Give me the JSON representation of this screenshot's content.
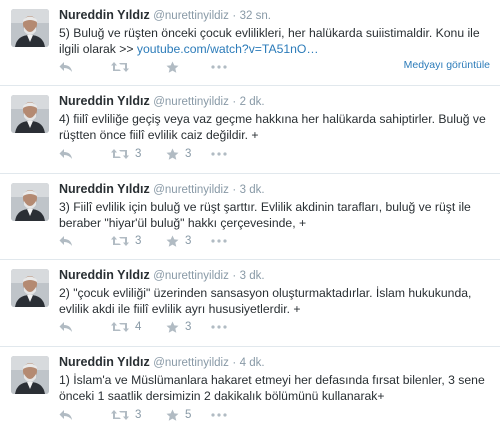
{
  "tweets": [
    {
      "name": "Nureddin Yıldız",
      "handle": "@nurettinyildiz",
      "time": "32 sn.",
      "text": "5) Buluğ ve rüşten önceki çocuk evlilikleri, her halükarda suiistimaldir. Konu ile ilgili olarak >> ",
      "link": "youtube.com/watch?v=TA51nO…",
      "retweets": "",
      "favorites": "",
      "media_label": "Medyayı görüntüle"
    },
    {
      "name": "Nureddin Yıldız",
      "handle": "@nurettinyildiz",
      "time": "2 dk.",
      "text": "4) fiilî evliliğe geçiş veya vaz geçme hakkına her halükarda sahiptirler. Buluğ ve rüştten önce fiilî evlilik caiz değildir. +",
      "retweets": "3",
      "favorites": "3"
    },
    {
      "name": "Nureddin Yıldız",
      "handle": "@nurettinyildiz",
      "time": "3 dk.",
      "text": "3) Fiilî evlilik için buluğ ve rüşt şarttır. Evlilik akdinin tarafları, buluğ ve rüşt ile beraber \"hiyar'ül buluğ\" hakkı çerçevesinde, +",
      "retweets": "3",
      "favorites": "3"
    },
    {
      "name": "Nureddin Yıldız",
      "handle": "@nurettinyildiz",
      "time": "3 dk.",
      "text": "2)  \"çocuk evliliği\" üzerinden sansasyon oluşturmaktadırlar. İslam hukukunda, evlilik akdi ile fiilî evlilik ayrı hususiyetlerdir. +",
      "retweets": "4",
      "favorites": "3"
    },
    {
      "name": "Nureddin Yıldız",
      "handle": "@nurettinyildiz",
      "time": "4 dk.",
      "text": "1) İslam'a ve Müslümanlara hakaret etmeyi her defasında fırsat bilenler, 3 sene önceki 1 saatlik dersimizin 2 dakikalık bölümünü kullanarak+",
      "retweets": "3",
      "favorites": "5"
    }
  ],
  "icons": {
    "reply": "reply-icon",
    "retweet": "retweet-icon",
    "favorite": "star-icon",
    "more": "more-icon"
  },
  "colors": {
    "link": "#2b7bb9",
    "muted": "#8899a6",
    "icon": "#b1bbc3",
    "divider": "#e1e8ed"
  }
}
